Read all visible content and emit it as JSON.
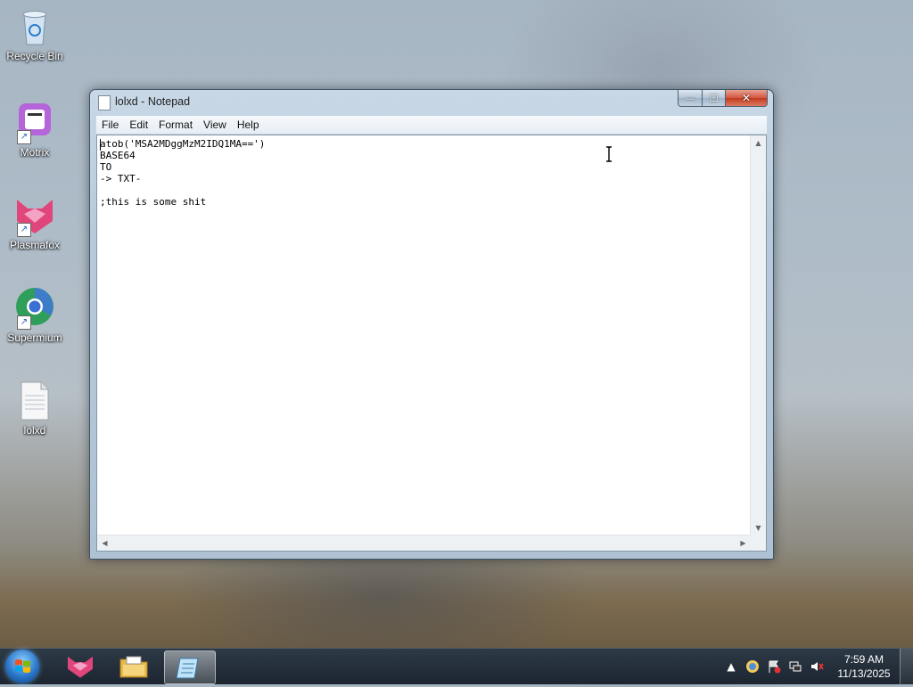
{
  "desktop": {
    "icons": [
      {
        "label": "Recycle Bin",
        "icon": "recycle-bin-icon"
      },
      {
        "label": "Motrix",
        "icon": "motrix-icon"
      },
      {
        "label": "Plasmafox",
        "icon": "plasmafox-icon"
      },
      {
        "label": "Supermium",
        "icon": "supermium-icon"
      },
      {
        "label": "lolxd",
        "icon": "text-file-icon"
      }
    ]
  },
  "window": {
    "title": "lolxd - Notepad",
    "buttons": {
      "minimize": "—",
      "maximize": "☐",
      "close": "✕"
    },
    "menu": [
      "File",
      "Edit",
      "Format",
      "View",
      "Help"
    ],
    "content": "atob('MSA2MDggMzM2IDQ1MA==')\nBASE64\nTO\n-> TXT-\n\n;this is some shit"
  },
  "taskbar": {
    "pinned": [
      "plasmafox-icon",
      "file-explorer-icon",
      "notepad-icon"
    ],
    "tray": [
      "show-hidden-icons-arrow",
      "network-globe-icon",
      "action-center-flag-icon",
      "network-icon",
      "volume-muted-icon"
    ],
    "time": "7:59 AM",
    "date": "11/13/2025"
  }
}
